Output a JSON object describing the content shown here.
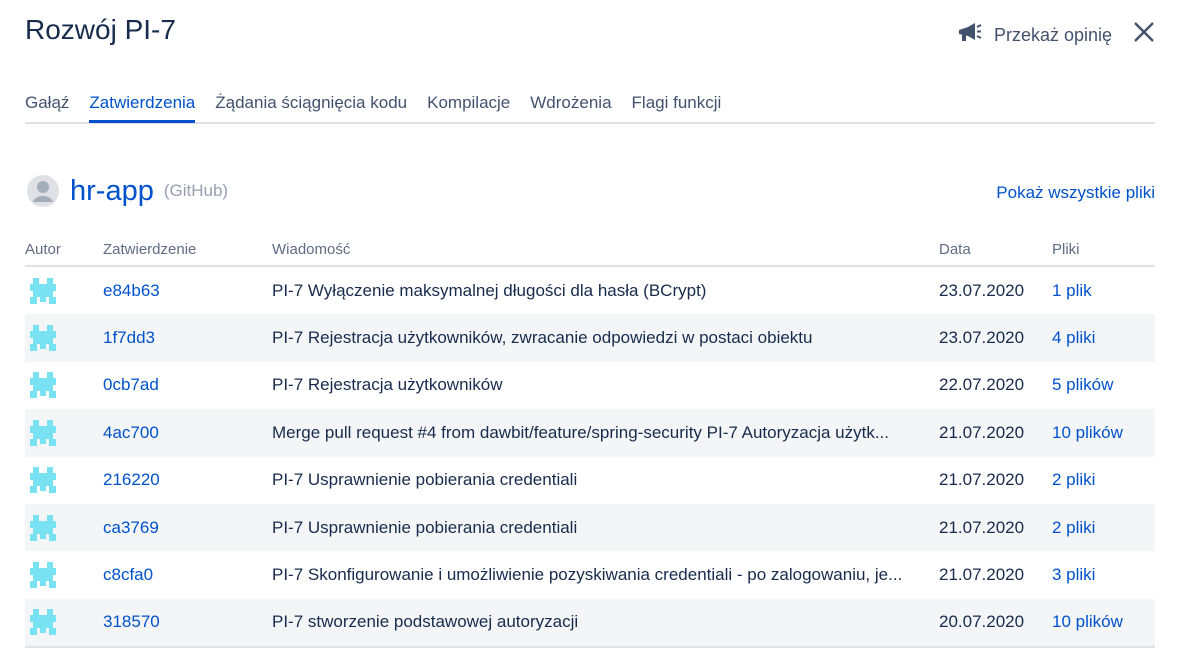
{
  "header": {
    "title": "Rozwój PI-7",
    "feedback_label": "Przekaż opinię",
    "feedback_icon": "megaphone-icon",
    "close_icon": "close-icon"
  },
  "tabs": [
    {
      "label": "Gałąź",
      "active": false
    },
    {
      "label": "Zatwierdzenia",
      "active": true
    },
    {
      "label": "Żądania ściągnięcia kodu",
      "active": false
    },
    {
      "label": "Kompilacje",
      "active": false
    },
    {
      "label": "Wdrożenia",
      "active": false
    },
    {
      "label": "Flagi funkcji",
      "active": false
    }
  ],
  "repo": {
    "name": "hr-app",
    "source": "(GitHub)",
    "show_all_label": "Pokaż wszystkie pliki"
  },
  "table": {
    "headers": {
      "author": "Autor",
      "commit": "Zatwierdzenie",
      "message": "Wiadomość",
      "date": "Data",
      "files": "Pliki"
    },
    "rows": [
      {
        "commit": "e84b63",
        "message": "PI-7 Wyłączenie maksymalnej długości dla hasła (BCrypt)",
        "date": "23.07.2020",
        "files": "1 plik"
      },
      {
        "commit": "1f7dd3",
        "message": "PI-7 Rejestracja użytkowników, zwracanie odpowiedzi w postaci obiektu",
        "date": "23.07.2020",
        "files": "4 pliki"
      },
      {
        "commit": "0cb7ad",
        "message": "PI-7 Rejestracja użytkowników",
        "date": "22.07.2020",
        "files": "5 plików"
      },
      {
        "commit": "4ac700",
        "message": "Merge pull request #4 from dawbit/feature/spring-security PI-7 Autoryzacja użytk...",
        "date": "21.07.2020",
        "files": "10 plików"
      },
      {
        "commit": "216220",
        "message": "PI-7 Usprawnienie pobierania credentiali",
        "date": "21.07.2020",
        "files": "2 pliki"
      },
      {
        "commit": "ca3769",
        "message": "PI-7 Usprawnienie pobierania credentiali",
        "date": "21.07.2020",
        "files": "2 pliki"
      },
      {
        "commit": "c8cfa0",
        "message": "PI-7 Skonfigurowanie i umożliwienie pozyskiwania credentiali - po zalogowaniu, je...",
        "date": "21.07.2020",
        "files": "3 pliki"
      },
      {
        "commit": "318570",
        "message": "PI-7 stworzenie podstawowej autoryzacji",
        "date": "20.07.2020",
        "files": "10 plików"
      }
    ]
  },
  "colors": {
    "accent": "#0052cc",
    "avatar": "#79e2f2",
    "row_alt": "#f4f5f7"
  }
}
